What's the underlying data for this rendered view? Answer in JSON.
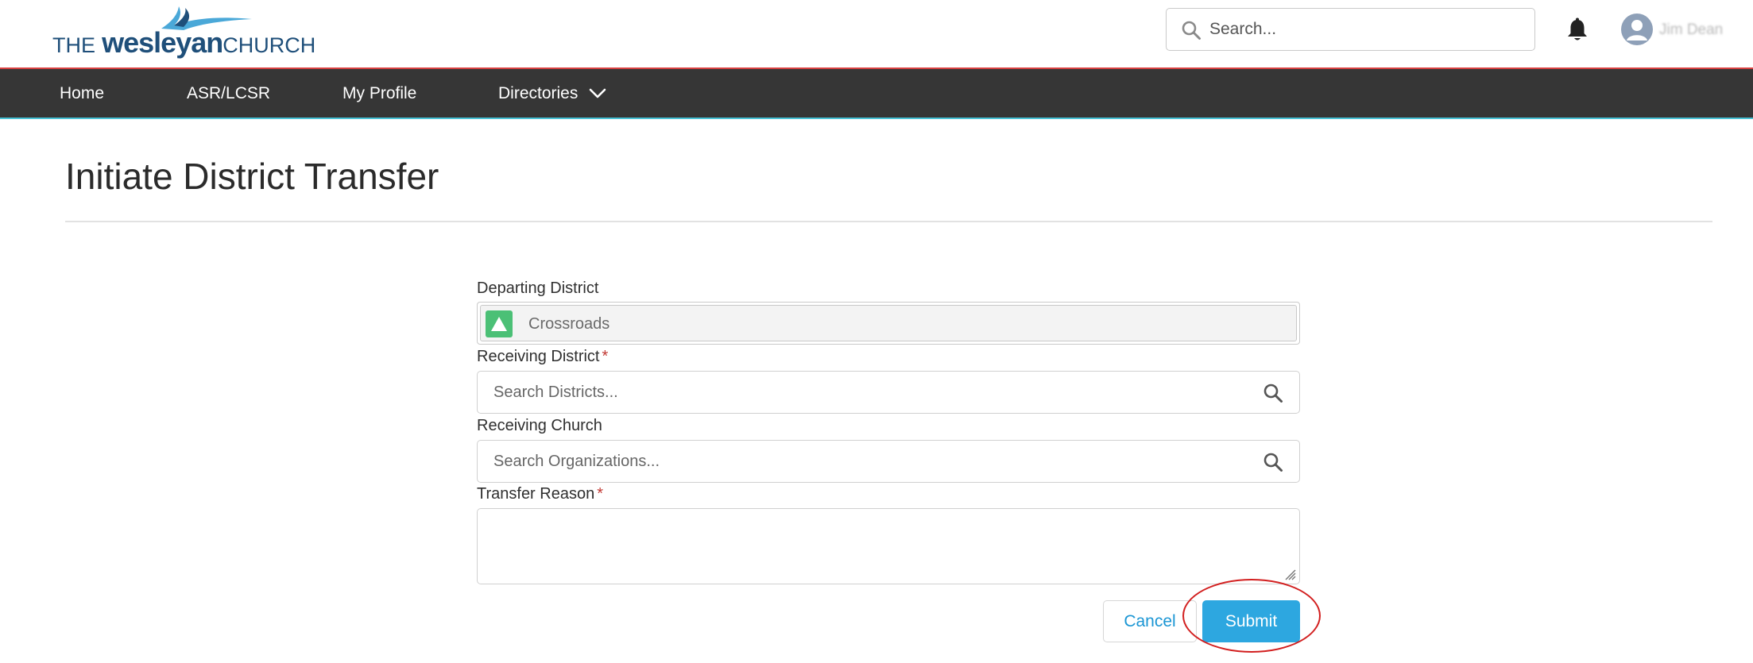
{
  "brand": {
    "logo_prefix": "THE",
    "logo_bold": "wesleyan",
    "logo_suffix": "CHURCH",
    "logo_color": "#1f4f7a",
    "accent_color": "#2da7e0"
  },
  "header": {
    "search": {
      "placeholder": "Search...",
      "icon": "search-icon"
    },
    "notifications_icon": "bell-icon",
    "user": {
      "name": "Jim Dean",
      "icon": "avatar-icon"
    }
  },
  "nav": {
    "items": [
      {
        "label": "Home"
      },
      {
        "label": "ASR/LCSR"
      },
      {
        "label": "My Profile"
      },
      {
        "label": "Directories",
        "icon": "chevron-down-icon"
      }
    ]
  },
  "page": {
    "title": "Initiate District Transfer"
  },
  "form": {
    "departing_district": {
      "label": "Departing District",
      "value": "Crossroads",
      "icon": "district-icon"
    },
    "receiving_district": {
      "label": "Receiving District",
      "required_mark": "*",
      "placeholder": "Search Districts...",
      "icon": "search-icon"
    },
    "receiving_church": {
      "label": "Receiving Church",
      "placeholder": "Search Organizations...",
      "icon": "search-icon"
    },
    "transfer_reason": {
      "label": "Transfer Reason",
      "required_mark": "*",
      "value": ""
    },
    "cancel_label": "Cancel",
    "submit_label": "Submit"
  }
}
